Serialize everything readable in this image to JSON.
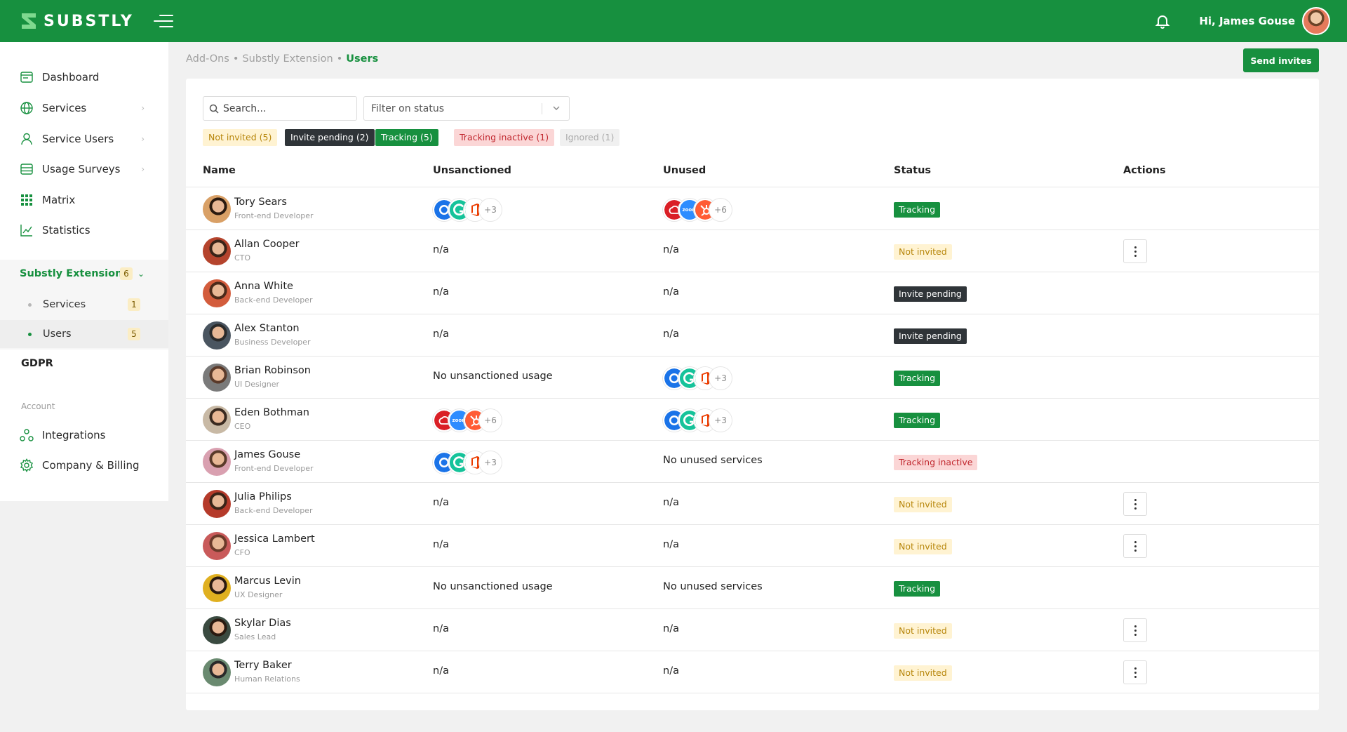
{
  "app": {
    "brand": "SUBSTLY",
    "greeting": "Hi, James Gouse"
  },
  "sidebar": {
    "items": [
      {
        "label": "Dashboard",
        "icon": "dashboard-icon"
      },
      {
        "label": "Services",
        "icon": "globe-icon"
      },
      {
        "label": "Service Users",
        "icon": "user-icon"
      },
      {
        "label": "Usage Surveys",
        "icon": "survey-icon"
      },
      {
        "label": "Matrix",
        "icon": "grid-icon"
      },
      {
        "label": "Statistics",
        "icon": "chart-icon"
      }
    ],
    "extension": {
      "label": "Substly Extension",
      "count": "6",
      "sub_items": [
        {
          "label": "Services",
          "count": "1"
        },
        {
          "label": "Users",
          "count": "5"
        }
      ]
    },
    "gdpr": "GDPR",
    "account_heading": "Account",
    "account_items": [
      {
        "label": "Integrations",
        "icon": "integrations-icon"
      },
      {
        "label": "Company & Billing",
        "icon": "gear-icon"
      }
    ]
  },
  "breadcrumb": {
    "items": [
      "Add-Ons",
      "Substly Extension"
    ],
    "current": "Users",
    "separator": "•"
  },
  "toolbar": {
    "send_invites": "Send invites"
  },
  "search": {
    "placeholder": "Search..."
  },
  "filter": {
    "placeholder": "Filter on status"
  },
  "chips": {
    "not_invited": "Not invited (5)",
    "invite_pending": "Invite pending (2)",
    "tracking": "Tracking (5)",
    "tracking_inactive": "Tracking inactive (1)",
    "ignored": "Ignored (1)"
  },
  "table": {
    "headers": {
      "name": "Name",
      "unsanctioned": "Unsanctioned",
      "unused": "Unused",
      "status": "Status",
      "actions": "Actions"
    },
    "rows": [
      {
        "name": "Tory Sears",
        "role": "Front-end Developer",
        "unsanctioned": "",
        "unused": "",
        "status": "Tracking"
      },
      {
        "name": "Allan Cooper",
        "role": "CTO",
        "unsanctioned": "n/a",
        "unused": "n/a",
        "status": "Not invited"
      },
      {
        "name": "Anna White",
        "role": "Back-end Developer",
        "unsanctioned": "n/a",
        "unused": "n/a",
        "status": "Invite pending"
      },
      {
        "name": "Alex Stanton",
        "role": "Business Developer",
        "unsanctioned": "n/a",
        "unused": "n/a",
        "status": "Invite pending"
      },
      {
        "name": "Brian Robinson",
        "role": "UI Designer",
        "unsanctioned": "No unsanctioned usage",
        "unused": "",
        "status": "Tracking"
      },
      {
        "name": "Eden Bothman",
        "role": "CEO",
        "unsanctioned": "",
        "unused": "",
        "status": "Tracking"
      },
      {
        "name": "James Gouse",
        "role": "Front-end Developer",
        "unsanctioned": "",
        "unused": "No unused services",
        "status": "Tracking inactive"
      },
      {
        "name": "Julia Philips",
        "role": "Back-end Developer",
        "unsanctioned": "n/a",
        "unused": "n/a",
        "status": "Not invited"
      },
      {
        "name": "Jessica Lambert",
        "role": "CFO",
        "unsanctioned": "n/a",
        "unused": "n/a",
        "status": "Not invited"
      },
      {
        "name": "Marcus Levin",
        "role": "UX Designer",
        "unsanctioned": "No unsanctioned usage",
        "unused": "No unused services",
        "status": "Tracking"
      },
      {
        "name": "Skylar Dias",
        "role": "Sales Lead",
        "unsanctioned": "n/a",
        "unused": "n/a",
        "status": "Not invited"
      },
      {
        "name": "Terry Baker",
        "role": "Human Relations",
        "unsanctioned": "n/a",
        "unused": "n/a",
        "status": "Not invited"
      }
    ],
    "service_stacks": {
      "set_a": {
        "icons": [
          "chrome-icon",
          "grammarly-icon",
          "office-icon"
        ],
        "more": "+3"
      },
      "set_b": {
        "icons": [
          "creative-cloud-icon",
          "zoom-icon",
          "hubspot-icon"
        ],
        "more": "+6",
        "zoom_text": "zoom"
      }
    }
  },
  "colors": {
    "brand": "#17903f",
    "tracking": "#17903f",
    "not_invited_bg": "#fff3d2",
    "pending_bg": "#2f3438",
    "inactive_bg": "#fbd6d6"
  }
}
